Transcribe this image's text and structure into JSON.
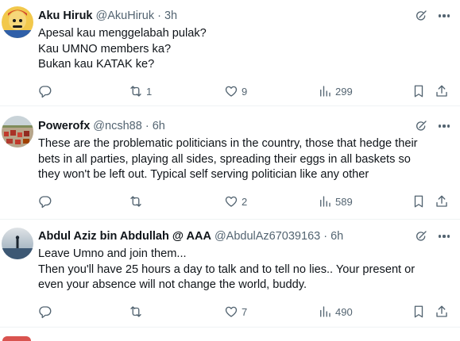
{
  "tweets": [
    {
      "name": "Aku Hiruk",
      "handle": "@AkuHiruk",
      "time": "3h",
      "lines": [
        "Apesal kau menggelabah pulak?",
        "Kau UMNO members ka?",
        "Bukan kau KATAK ke?"
      ],
      "replies": "",
      "retweets": "1",
      "likes": "9",
      "views": "299"
    },
    {
      "name": "Powerofx",
      "handle": "@ncsh88",
      "time": "6h",
      "lines": [
        "These are the problematic politicians in the country, those that hedge their",
        "bets in all parties, playing all sides, spreading their eggs in all baskets so",
        "they won't be left out. Typical self serving politician like any other"
      ],
      "replies": "",
      "retweets": "",
      "likes": "2",
      "views": "589"
    },
    {
      "name": "Abdul Aziz bin Abdullah @ AAA",
      "handle": "@AbdulAz67039163",
      "time": "6h",
      "lines": [
        "Leave Umno and join them...",
        "Then you'll have 25 hours a day to talk and to tell no lies.. Your present or",
        "even your absence will not change the world, buddy."
      ],
      "replies": "",
      "retweets": "",
      "likes": "7",
      "views": "490"
    }
  ],
  "separator": "·",
  "colors": {
    "text": "#0f1419",
    "secondary": "#536471",
    "divider": "#eff3f4"
  },
  "icons": [
    "reply-icon",
    "retweet-icon",
    "like-icon",
    "views-icon",
    "bookmark-icon",
    "share-icon",
    "grok-icon",
    "more-icon"
  ]
}
